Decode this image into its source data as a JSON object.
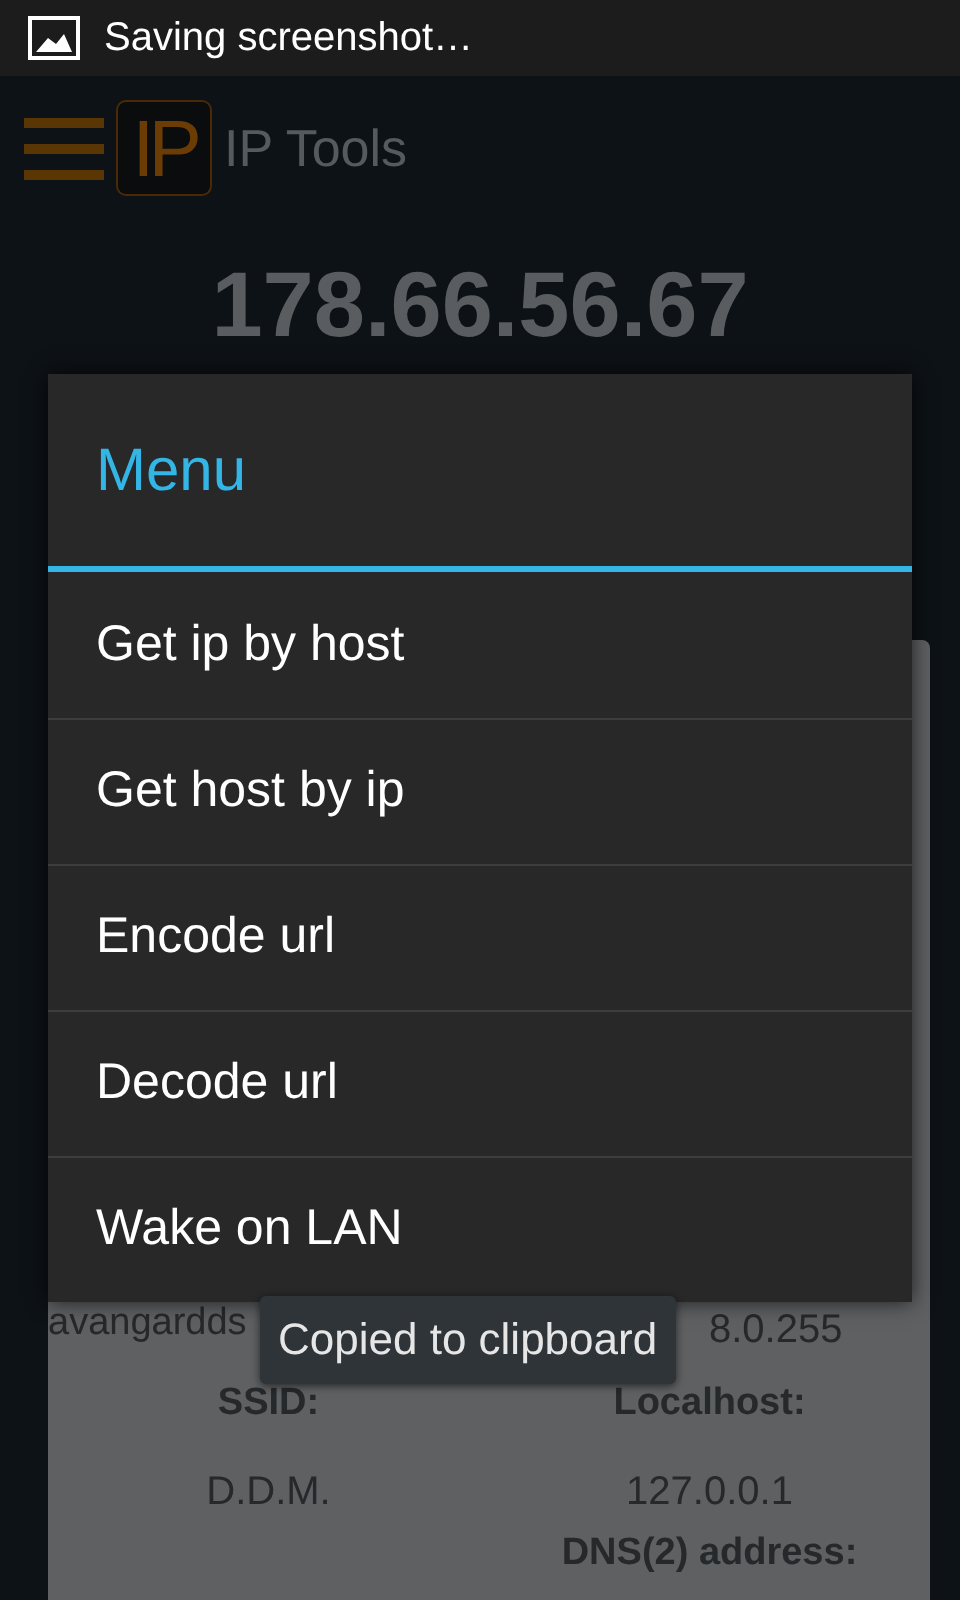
{
  "status_bar": {
    "notification": "Saving screenshot…"
  },
  "app_bar": {
    "logo": "IP",
    "title": "IP Tools"
  },
  "ip_address": "178.66.56.67",
  "info_card": {
    "left_text": [
      "avangardds"
    ],
    "right_text": "8.0.255",
    "fields": [
      {
        "label": "SSID:",
        "value": "D.D.M."
      },
      {
        "label": "Localhost:",
        "value": "127.0.0.1"
      }
    ],
    "next_label": "DNS(2) address:"
  },
  "dialog": {
    "title": "Menu",
    "items": [
      "Get ip by host",
      "Get host by ip",
      "Encode url",
      "Decode url",
      "Wake on LAN"
    ]
  },
  "toast": "Copied to clipboard"
}
